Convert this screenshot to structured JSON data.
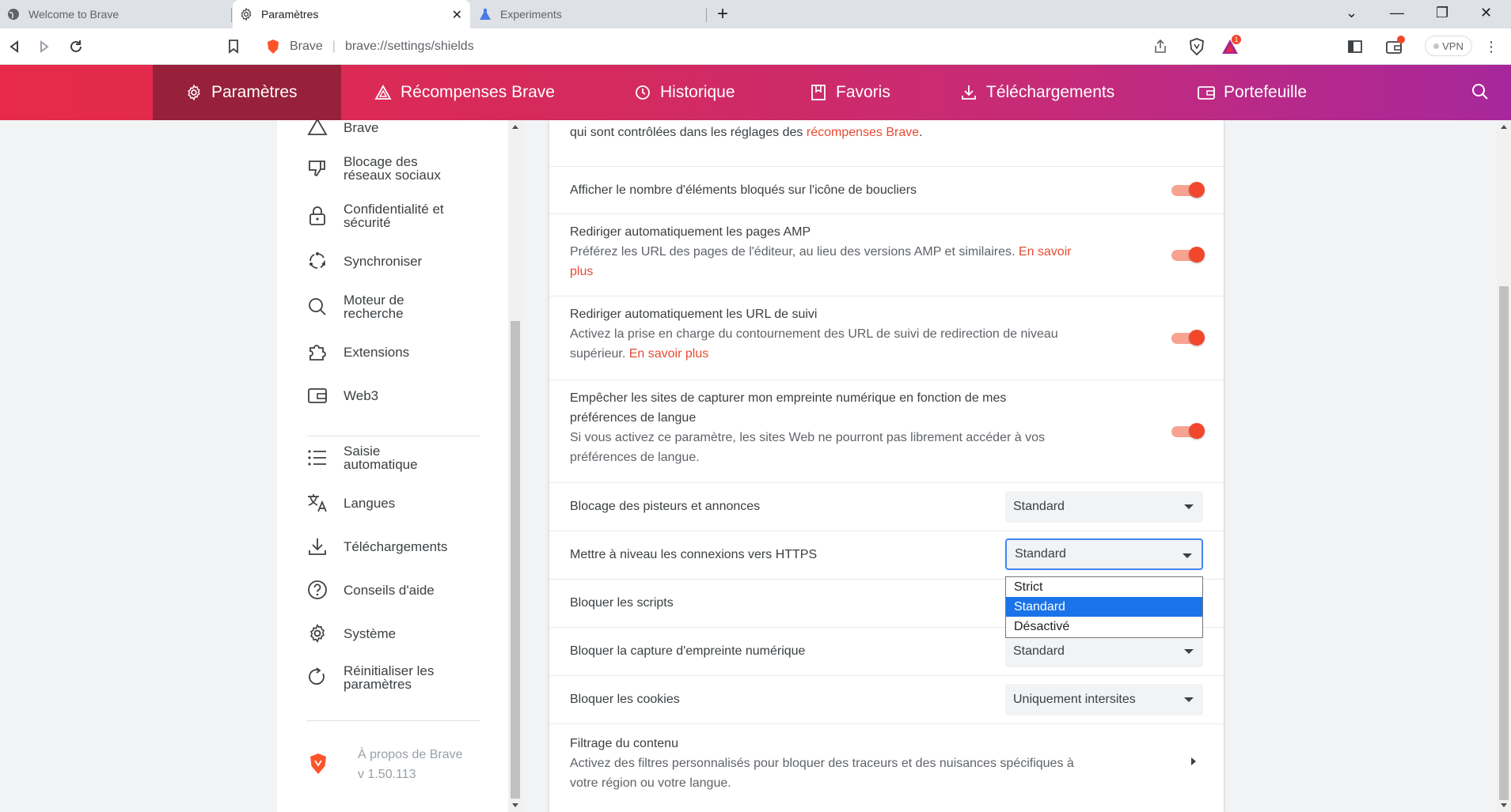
{
  "tabs": [
    {
      "title": "Welcome to Brave",
      "icon": "globe-icon"
    },
    {
      "title": "Paramètres",
      "icon": "gear-icon",
      "active": true
    },
    {
      "title": "Experiments",
      "icon": "flask-icon"
    }
  ],
  "toolbar": {
    "brand": "Brave",
    "url": "brave://settings/shields",
    "vpn_label": "VPN",
    "rewards_badge": "1"
  },
  "nav": [
    {
      "label": "Paramètres",
      "icon": "gear-icon",
      "active": true
    },
    {
      "label": "Récompenses Brave",
      "icon": "triangle-icon"
    },
    {
      "label": "Historique",
      "icon": "history-icon"
    },
    {
      "label": "Favoris",
      "icon": "bookmark-icon"
    },
    {
      "label": "Téléchargements",
      "icon": "download-icon"
    },
    {
      "label": "Portefeuille",
      "icon": "wallet-icon"
    }
  ],
  "sidebar": {
    "items": [
      {
        "label": "Brave",
        "icon": "rewards-icon"
      },
      {
        "label": "Blocage des réseaux sociaux",
        "line1": "Blocage des",
        "line2": "réseaux sociaux",
        "icon": "thumbs-down-icon"
      },
      {
        "label": "Confidentialité et sécurité",
        "line1": "Confidentialité et",
        "line2": "sécurité",
        "icon": "lock-icon"
      },
      {
        "label": "Synchroniser",
        "icon": "sync-icon"
      },
      {
        "label": "Moteur de recherche",
        "line1": "Moteur de",
        "line2": "recherche",
        "icon": "search-icon"
      },
      {
        "label": "Extensions",
        "icon": "puzzle-icon"
      },
      {
        "label": "Web3",
        "icon": "wallet-icon"
      },
      {
        "label": "Saisie automatique",
        "line1": "Saisie",
        "line2": "automatique",
        "icon": "list-icon"
      },
      {
        "label": "Langues",
        "icon": "translate-icon"
      },
      {
        "label": "Téléchargements",
        "icon": "download-icon"
      },
      {
        "label": "Conseils d'aide",
        "icon": "help-icon"
      },
      {
        "label": "Système",
        "icon": "gear-icon"
      },
      {
        "label": "Réinitialiser les paramètres",
        "line1": "Réinitialiser les",
        "line2": "paramètres",
        "icon": "reset-icon"
      }
    ],
    "about": {
      "title": "À propos de Brave",
      "version": "v 1.50.113"
    }
  },
  "main": {
    "top_text": "qui sont contrôlées dans les réglages des ",
    "top_link": "récompenses Brave",
    "top_suffix": ".",
    "rows": [
      {
        "title": "Afficher le nombre d'éléments bloqués sur l'icône de boucliers",
        "toggle": true
      },
      {
        "title": "Rediriger automatiquement les pages AMP",
        "desc": "Préférez les URL des pages de l'éditeur, au lieu des versions AMP et similaires. ",
        "desc_line2": "",
        "link": "En savoir",
        "link2": "plus",
        "toggle": true
      },
      {
        "title": "Rediriger automatiquement les URL de suivi",
        "desc": "Activez la prise en charge du contournement des URL de suivi de redirection de niveau",
        "desc_line2": "supérieur. ",
        "link": "En savoir plus",
        "toggle": true
      },
      {
        "title": "Empêcher les sites de capturer mon empreinte numérique en fonction de mes",
        "title_line2": "préférences de langue",
        "desc": "Si vous activez ce paramètre, les sites Web ne pourront pas librement accéder à vos",
        "desc_line2": "préférences de langue.",
        "toggle": true
      },
      {
        "title": "Blocage des pisteurs et annonces",
        "select": "Standard"
      },
      {
        "title": "Mettre à niveau les connexions vers HTTPS",
        "select": "Standard",
        "focused": true
      },
      {
        "title": "Bloquer les scripts"
      },
      {
        "title": "Bloquer la capture d'empreinte numérique",
        "select": "Standard"
      },
      {
        "title": "Bloquer les cookies",
        "select": "Uniquement intersites"
      },
      {
        "title": "Filtrage du contenu",
        "desc": "Activez des filtres personnalisés pour bloquer des traceurs et des nuisances spécifiques à",
        "desc_line2": "votre région ou votre langue."
      }
    ],
    "dropdown_options": [
      "Strict",
      "Standard",
      "Désactivé"
    ],
    "dropdown_selected": "Standard"
  },
  "colors": {
    "accent": "#f1472c",
    "header_start": "#e72a48",
    "header_end": "#a7279b",
    "link": "#e64b32",
    "selection": "#1a73e8"
  }
}
